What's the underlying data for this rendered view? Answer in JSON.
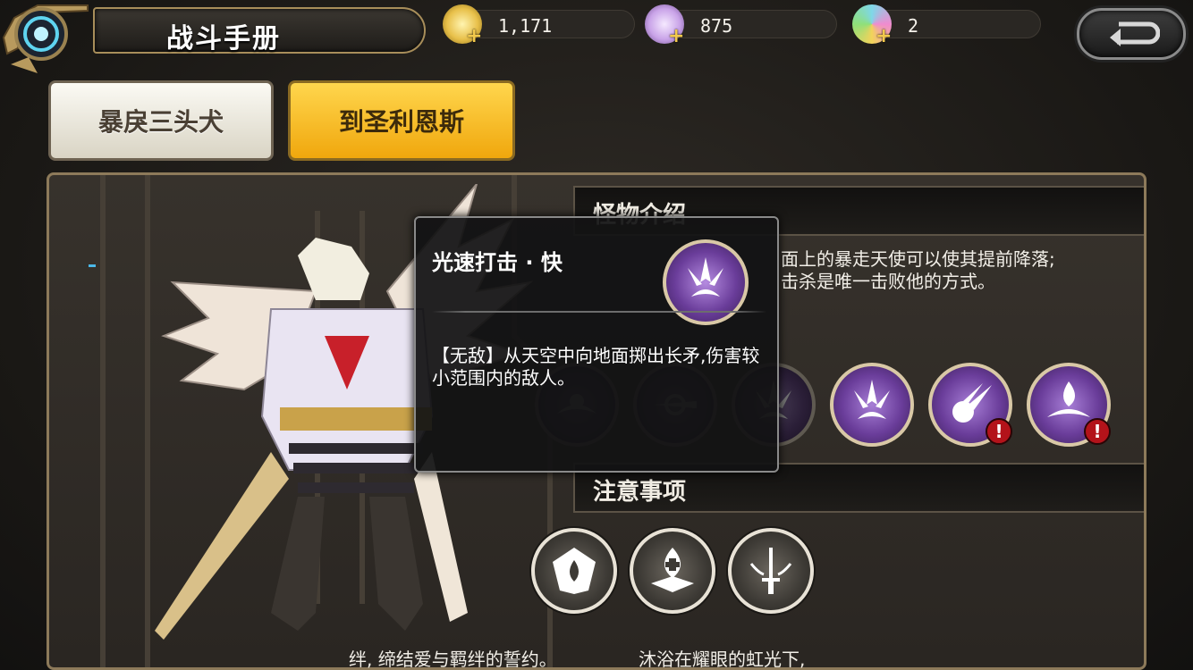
{
  "header": {
    "title": "战斗手册"
  },
  "currencies": [
    {
      "name": "gold",
      "value": "1,171",
      "color": "#e8c04a"
    },
    {
      "name": "crystal",
      "value": "875",
      "color": "#c9a3e8"
    },
    {
      "name": "gem",
      "value": "2",
      "color": "#7fd7e8"
    }
  ],
  "tabs": [
    {
      "label": "暴戾三头犬",
      "selected": false
    },
    {
      "label": "到圣利恩斯",
      "selected": true
    }
  ],
  "monster_intro": {
    "header": "怪物介绍",
    "text_lines": [
      "面上的暴走天使可以使其提前降落;",
      "击杀是唯一击败他的方式。"
    ]
  },
  "skills": [
    {
      "icon": "wave-icon",
      "dimmed": true,
      "alert": false
    },
    {
      "icon": "blade-icon",
      "dimmed": true,
      "alert": false
    },
    {
      "icon": "spear-burst-icon",
      "dimmed": true,
      "alert": false
    },
    {
      "icon": "spear-burst-icon",
      "dimmed": false,
      "alert": false
    },
    {
      "icon": "comet-icon",
      "dimmed": false,
      "alert": true
    },
    {
      "icon": "flame-wave-icon",
      "dimmed": false,
      "alert": true
    }
  ],
  "alert_mark": "!",
  "notes": {
    "header": "注意事项",
    "icons": [
      "shield-flame-icon",
      "heal-drop-icon",
      "sword-icon"
    ]
  },
  "tooltip": {
    "title": "光速打击 · 快",
    "desc": "【无敌】从天空中向地面掷出长矛,伤害较小范围内的敌人。"
  },
  "ticker": {
    "left": "绊, 缔结爱与羁绊的誓约。",
    "right": "沐浴在耀眼的虹光下,"
  }
}
